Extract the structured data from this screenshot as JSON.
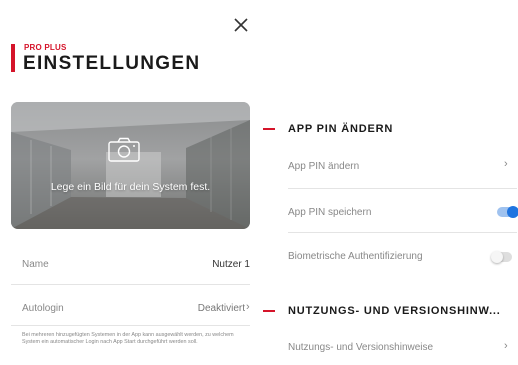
{
  "header": {
    "close_icon": "close-icon",
    "brand": "PRO PLUS",
    "title": "EINSTELLUNGEN",
    "accent_color": "#d5142a"
  },
  "left": {
    "photo": {
      "label": "Lege ein Bild für dein System fest.",
      "icon": "camera-icon"
    },
    "name_row": {
      "label": "Name",
      "value": "Nutzer 1"
    },
    "autologin_row": {
      "label": "Autologin",
      "value": "Deaktiviert"
    },
    "hint": "Bei mehreren hinzugefügten Systemen in der App kann ausgewählt werden, zu welchem System ein automatischer Login nach App Start durchgeführt werden soll."
  },
  "right": {
    "pin_section": {
      "title": "APP PIN ÄNDERN",
      "rows": [
        {
          "label": "App PIN ändern",
          "control": "chevron"
        },
        {
          "label": "App PIN speichern",
          "control": "toggle",
          "enabled": true
        },
        {
          "label": "Biometrische Authentifizierung",
          "control": "toggle",
          "enabled": false
        }
      ]
    },
    "usage_section": {
      "title": "NUTZUNGS- UND VERSIONSHINW...",
      "rows": [
        {
          "label": "Nutzungs- und Versionshinweise",
          "control": "chevron"
        }
      ]
    },
    "toggle_on_color": "#1f74e0"
  }
}
